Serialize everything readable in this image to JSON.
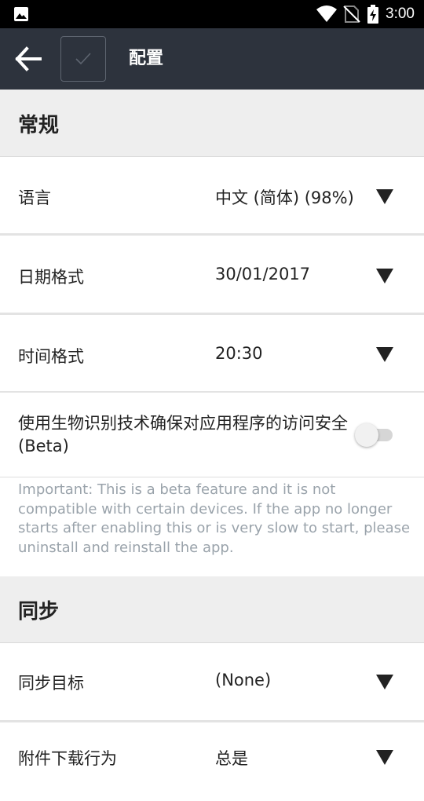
{
  "status_bar": {
    "time": "3:00",
    "icons": [
      "image-icon",
      "wifi-icon",
      "no-sim-icon",
      "battery-charging-icon"
    ]
  },
  "app_bar": {
    "back_icon": "arrow-left-icon",
    "save_icon": "check-icon",
    "title": "配置"
  },
  "sections": {
    "general": {
      "title": "常规",
      "language": {
        "label": "语言",
        "value": "中文 (简体) (98%)"
      },
      "date_format": {
        "label": "日期格式",
        "value": "30/01/2017"
      },
      "time_format": {
        "label": "时间格式",
        "value": "20:30"
      },
      "biometrics": {
        "label": "使用生物识别技术确保对应用程序的访问安全 (Beta)",
        "enabled": false
      },
      "note": "Important: This is a beta feature and it is not compatible with certain devices. If the app no longer starts after enabling this or is very slow to start, please uninstall and reinstall the app."
    },
    "sync": {
      "title": "同步",
      "target": {
        "label": "同步目标",
        "value": "(None)"
      },
      "attachment_download": {
        "label": "附件下载行为",
        "value": "总是"
      }
    }
  },
  "colors": {
    "app_bar": "#2d333d",
    "status_bar": "#000000",
    "section_bg": "#eeeeee",
    "note_text": "#9aa3ab"
  }
}
